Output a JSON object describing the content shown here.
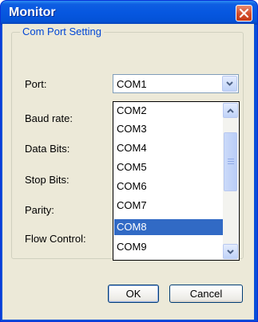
{
  "window": {
    "title": "Monitor"
  },
  "group": {
    "title": "Com Port Setting"
  },
  "labels": {
    "port": "Port:",
    "baud": "Baud rate:",
    "data_bits": "Data Bits:",
    "stop_bits": "Stop Bits:",
    "parity": "Parity:",
    "flow": "Flow Control:"
  },
  "port_combo": {
    "value": "COM1"
  },
  "dropdown": {
    "options": [
      "COM2",
      "COM3",
      "COM4",
      "COM5",
      "COM6",
      "COM7",
      "COM8",
      "COM9"
    ],
    "selected": "COM8"
  },
  "buttons": {
    "ok": "OK",
    "cancel": "Cancel"
  },
  "icons": {
    "close": "close-icon",
    "combo_arrow": "chevron-down-icon",
    "scroll_up": "chevron-up-icon",
    "scroll_down": "chevron-down-icon"
  },
  "colors": {
    "titlebar": "#0657e0",
    "close_button": "#d24d2a",
    "group_title": "#0046d5",
    "selection": "#316ac5",
    "dialog_bg": "#ece9d8"
  }
}
